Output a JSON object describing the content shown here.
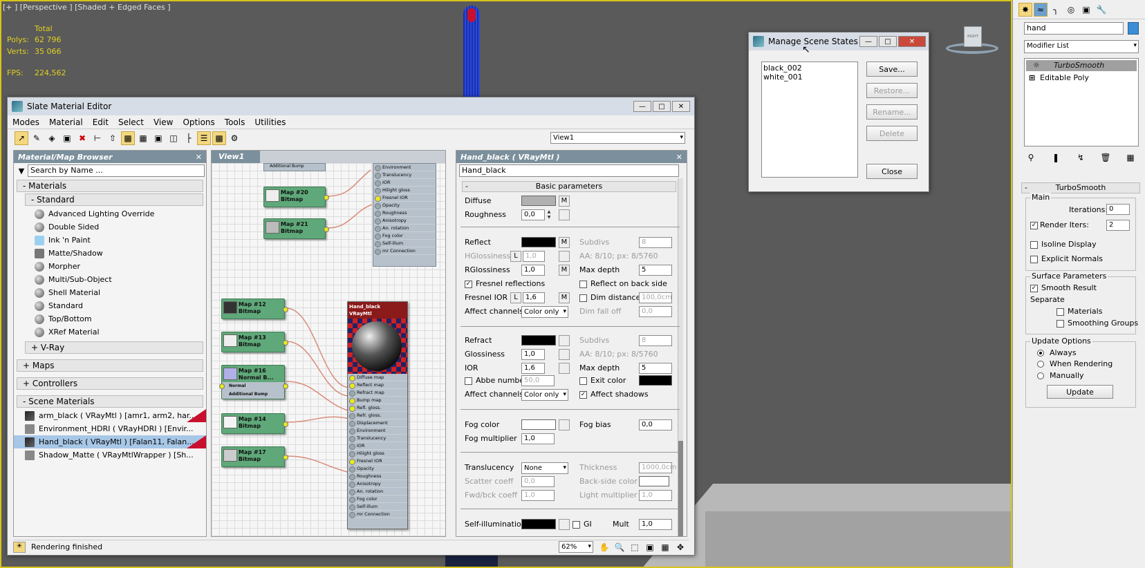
{
  "viewport": {
    "label": "[+ ] [Perspective ] [Shaded + Edged Faces ]",
    "total": "Total",
    "polys_label": "Polys:",
    "polys_value": "62 796",
    "verts_label": "Verts:",
    "verts_value": "35 066",
    "fps_label": "FPS:",
    "fps_value": "224,562",
    "viewcube_label": "RIGHT"
  },
  "sme": {
    "title": "Slate Material Editor",
    "menu": [
      "Modes",
      "Material",
      "Edit",
      "Select",
      "View",
      "Options",
      "Tools",
      "Utilities"
    ],
    "view_select": "View1",
    "browser": {
      "title": "Material/Map Browser",
      "search_placeholder": "Search by Name ...",
      "groups": {
        "materials": "- Materials",
        "standard": "- Standard",
        "vray": "+ V-Ray",
        "maps": "+ Maps",
        "controllers": "+ Controllers",
        "scene": "- Scene Materials"
      },
      "standard_items": [
        "Advanced Lighting Override",
        "Double Sided",
        "Ink 'n Paint",
        "Matte/Shadow",
        "Morpher",
        "Multi/Sub-Object",
        "Shell Material",
        "Standard",
        "Top/Bottom",
        "XRef Material"
      ],
      "scene_items": [
        "arm_black  ( VRayMtl )  [amr1, arm2, har...",
        "Environment_HDRI  ( VRayHDRI )  [Envir...",
        "Hand_black  ( VRayMtl )  [Falan11, Falan...",
        "Shadow_Matte  ( VRayMtlWrapper )  [Sh..."
      ]
    },
    "view_tab": "View1",
    "nodes": {
      "map20": "Map #20\nBitmap",
      "map21": "Map #21\nBitmap",
      "map12": "Map #12\nBitmap",
      "map13": "Map #13\nBitmap",
      "map16": "Map #16\nNormal B...",
      "map14": "Map #14\nBitmap",
      "map17": "Map #17\nBitmap",
      "additional_bump": "Additional Bump",
      "normal": "Normal",
      "main_title": "Hand_black\nVRayMtl"
    },
    "top_slots": [
      "Environment",
      "Translucency",
      "IOR",
      "Hilight gloss",
      "Fresnel IOR",
      "Opacity",
      "Roughness",
      "Anisotropy",
      "An. rotation",
      "Fog color",
      "Self-illum",
      "mr Connection"
    ],
    "main_slots": [
      "Diffuse map",
      "Reflect map",
      "Refract map",
      "Bump map",
      "Refl. gloss.",
      "Refr. gloss.",
      "Displacement",
      "Environment",
      "Translucency",
      "IOR",
      "Hilight gloss",
      "Fresnel IOR",
      "Opacity",
      "Roughness",
      "Anisotropy",
      "An. rotation",
      "Fog color",
      "Self-illum",
      "mr Connection"
    ],
    "params": {
      "header": "Hand_black  ( VRayMtl )",
      "name": "Hand_black",
      "rollout": "Basic parameters",
      "diffuse": "Diffuse",
      "m": "M",
      "roughness": "Roughness",
      "roughness_val": "0,0",
      "reflect": "Reflect",
      "subdivs": "Subdivs",
      "subdivs_val": "8",
      "hgloss": "HGlossiness",
      "l": "L",
      "hgloss_val": "1,0",
      "aa": "AA: 8/10; px: 8/5760",
      "rgloss": "RGlossiness",
      "rgloss_val": "1,0",
      "maxdepth": "Max depth",
      "maxdepth_val": "5",
      "fresnel": "Fresnel reflections",
      "backside": "Reflect on back side",
      "fior": "Fresnel IOR",
      "fior_val": "1,6",
      "dimdist": "Dim distance",
      "dimdist_val": "100,0cm",
      "affect": "Affect channels",
      "coloronly": "Color only",
      "dimfall": "Dim fall off",
      "dimfall_val": "0,0",
      "refract": "Refract",
      "gloss": "Glossiness",
      "gloss_val": "1,0",
      "ior": "IOR",
      "ior_val": "1,6",
      "abbe": "Abbe number",
      "abbe_val": "50,0",
      "exitcolor": "Exit color",
      "affshadows": "Affect shadows",
      "fogcolor": "Fog color",
      "fogbias": "Fog bias",
      "fogbias_val": "0,0",
      "fogmult": "Fog multiplier",
      "fogmult_val": "1,0",
      "transl": "Translucency",
      "transl_val": "None",
      "thickness": "Thickness",
      "thickness_val": "1000,0cm",
      "scatter": "Scatter coeff",
      "scatter_val": "0,0",
      "backside_color": "Back-side color",
      "fwdbck": "Fwd/bck coeff",
      "fwdbck_val": "1,0",
      "lightmult": "Light multiplier",
      "lightmult_val": "1,0",
      "selfillum": "Self-illumination",
      "gi": "GI",
      "mult": "Mult",
      "mult_val": "1,0"
    },
    "status": "Rendering finished",
    "zoom": "62%"
  },
  "mss": {
    "title": "Manage Scene States",
    "states": [
      "black_002",
      "white_001"
    ],
    "save": "Save...",
    "restore": "Restore...",
    "rename": "Rename...",
    "delete": "Delete",
    "close": "Close"
  },
  "cmd": {
    "search_value": "hand",
    "modifier_list": "Modifier List",
    "stack": [
      "TurboSmooth",
      "Editable Poly"
    ],
    "rollout": "TurboSmooth",
    "main": "Main",
    "iterations": "Iterations:",
    "iterations_val": "0",
    "render_iters": "Render Iters:",
    "render_iters_val": "2",
    "isoline": "Isoline Display",
    "explicit": "Explicit Normals",
    "surface": "Surface Parameters",
    "smooth": "Smooth Result",
    "separate": "Separate",
    "materials": "Materials",
    "smoothing": "Smoothing Groups",
    "update_options": "Update Options",
    "always": "Always",
    "when_rendering": "When Rendering",
    "manually": "Manually",
    "update": "Update"
  },
  "colors": {
    "viewport_bg": "#5a5a5a",
    "viewport_text": "#e0d020",
    "node_green": "#5fa879",
    "main_node_title": "#8b1a1a",
    "panel_header": "#7b8f9c",
    "selection_blue": "#a7c7e7"
  }
}
